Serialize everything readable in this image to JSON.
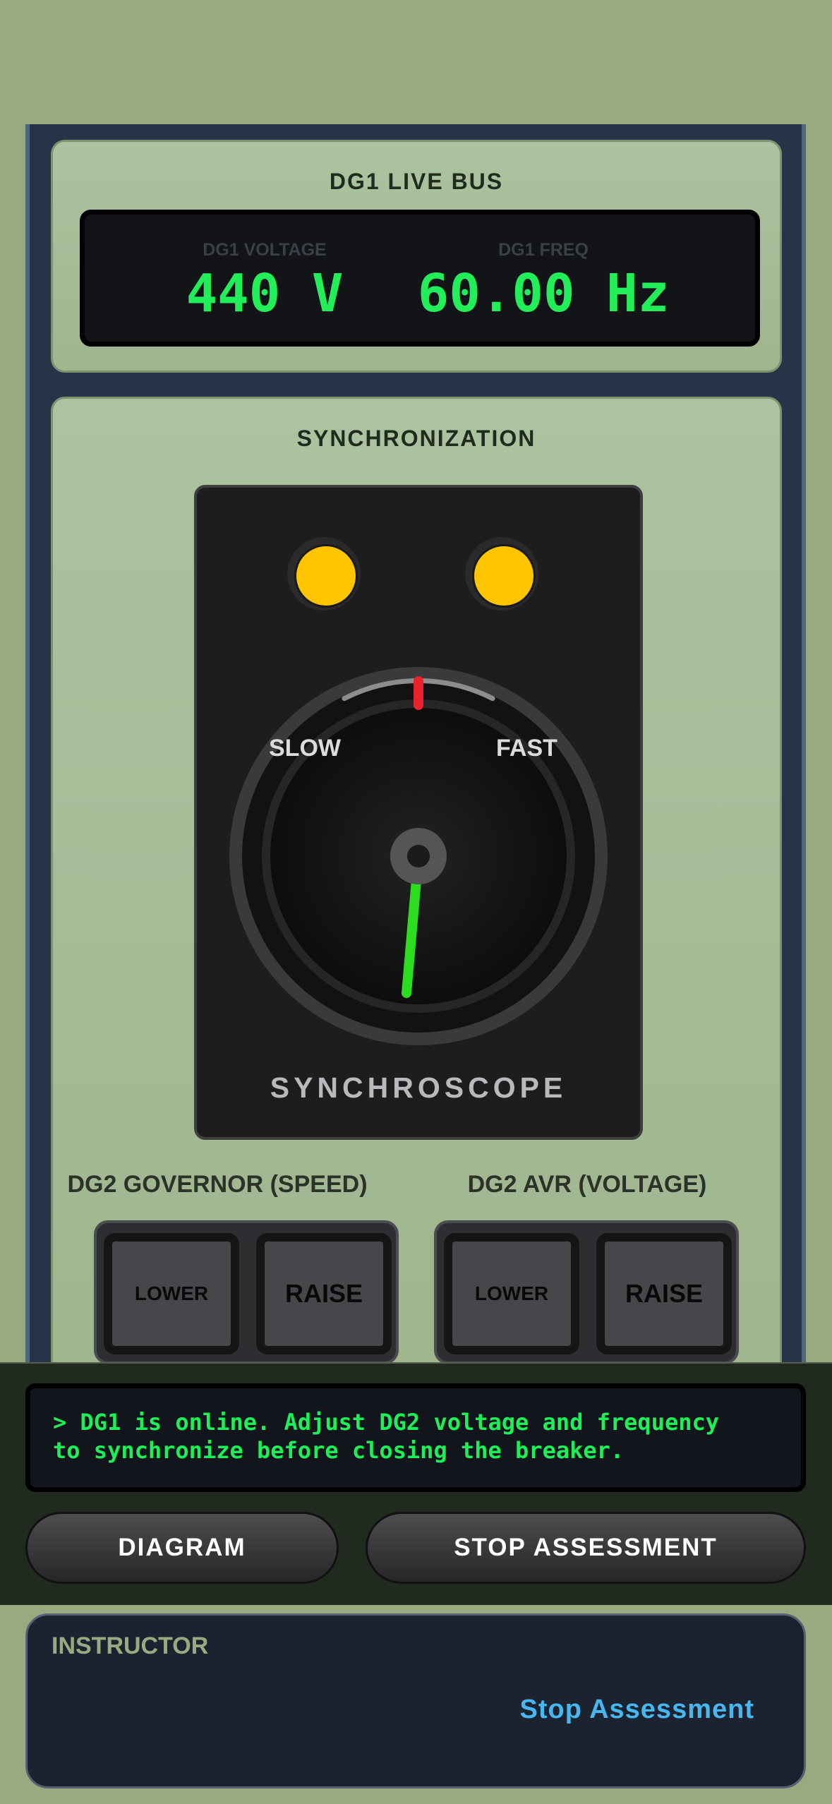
{
  "live_bus": {
    "title": "DG1 LIVE BUS",
    "voltage_label": "DG1 VOLTAGE",
    "voltage_value": "440 V",
    "freq_label": "DG1 FREQ",
    "freq_value": "60.00 Hz"
  },
  "sync": {
    "title": "SYNCHRONIZATION",
    "slow_label": "SLOW",
    "fast_label": "FAST",
    "synchroscope_label": "SYNCHROSCOPE",
    "lamp_color": "#ffc500",
    "needle_color": "#2bdc1f",
    "zero_mark_color": "#e8232e"
  },
  "governor": {
    "title": "DG2 GOVERNOR (SPEED)",
    "lower_label": "LOWER",
    "raise_label": "RAISE"
  },
  "avr": {
    "title": "DG2 AVR (VOLTAGE)",
    "lower_label": "LOWER",
    "raise_label": "RAISE"
  },
  "console": {
    "message_line1": "> DG1 is online. Adjust DG2 voltage and frequency",
    "message_line2": "to synchronize before closing the breaker.",
    "diagram_button": "DIAGRAM",
    "stop_button": "STOP ASSESSMENT"
  },
  "instructor": {
    "title": "INSTRUCTOR",
    "link": "Stop Assessment",
    "link_color": "#49b7ef"
  }
}
